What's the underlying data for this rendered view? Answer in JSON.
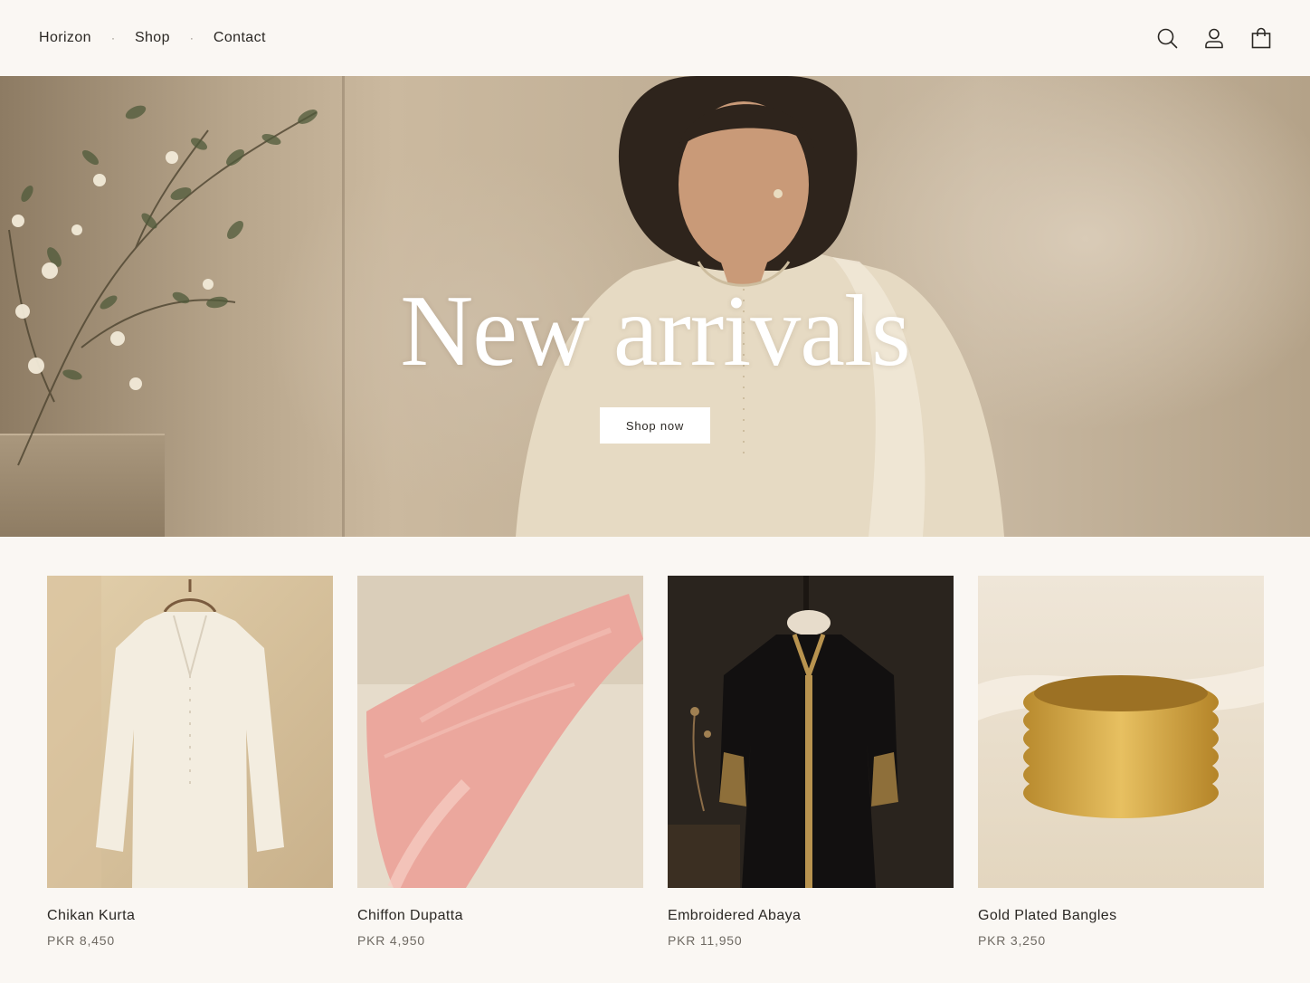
{
  "header": {
    "nav": [
      {
        "label": "Horizon"
      },
      {
        "label": "Shop"
      },
      {
        "label": "Contact"
      }
    ],
    "separator": "·",
    "icons": [
      "search-icon",
      "account-icon",
      "cart-icon"
    ]
  },
  "hero": {
    "title": "New arrivals",
    "cta_label": "Shop now"
  },
  "products": [
    {
      "name": "Chikan Kurta",
      "price": "PKR 8,450"
    },
    {
      "name": "Chiffon Dupatta",
      "price": "PKR 4,950"
    },
    {
      "name": "Embroidered Abaya",
      "price": "PKR 11,950"
    },
    {
      "name": "Gold Plated Bangles",
      "price": "PKR 3,250"
    }
  ],
  "colors": {
    "background": "#faf7f3",
    "text": "#2b2824",
    "muted_text": "#6f6a63"
  }
}
